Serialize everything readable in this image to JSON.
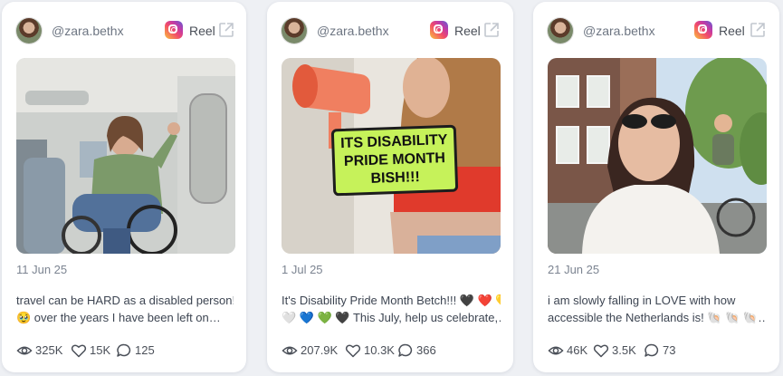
{
  "cards": [
    {
      "handle": "@zara.bethx",
      "type_label": "Reel",
      "date": "11 Jun 25",
      "caption_line1": "travel can be HARD as a disabled person!",
      "caption_line2": "🥹 over the years I have been left on…",
      "views": "325K",
      "likes": "15K",
      "comments": "125"
    },
    {
      "handle": "@zara.bethx",
      "type_label": "Reel",
      "date": "1 Jul 25",
      "overlay_text": "ITS DISABILITY PRIDE MONTH BISH!!!",
      "caption_line1": "It's Disability Pride Month Betch!!! 🖤 ❤️ 💛",
      "caption_line2": "🤍 💙 💚 🖤 This July, help us celebrate,…",
      "views": "207.9K",
      "likes": "10.3K",
      "comments": "366"
    },
    {
      "handle": "@zara.bethx",
      "type_label": "Reel",
      "date": "21 Jun 25",
      "caption_line1": "i am slowly falling in LOVE with how",
      "caption_line2": "accessible the Netherlands is! 🐚 🐚 🐚…",
      "views": "46K",
      "likes": "3.5K",
      "comments": "73"
    }
  ]
}
